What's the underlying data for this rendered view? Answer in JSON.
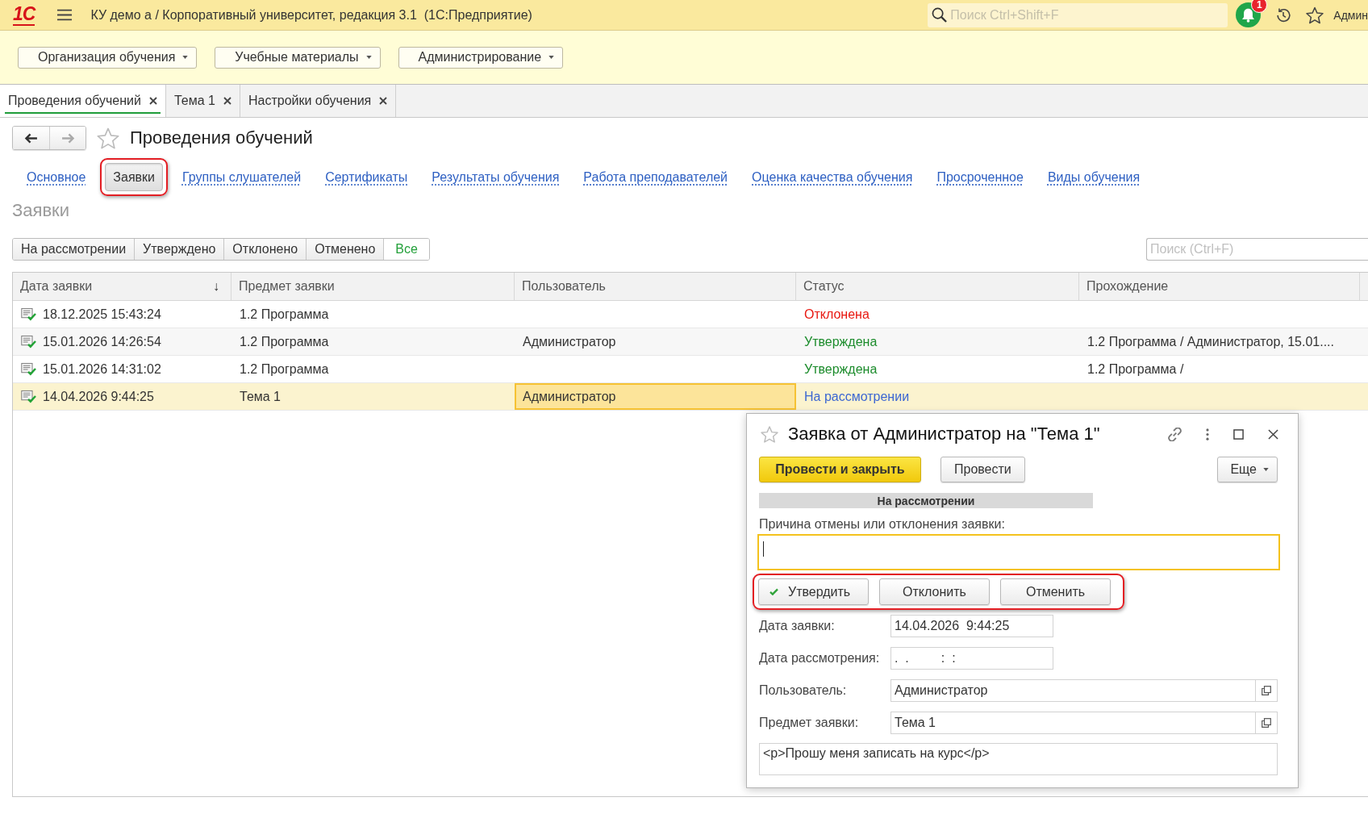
{
  "top_bar": {
    "logo": "1С",
    "title": "КУ демо а / Корпоративный университет, редакция 3.1  (1С:Предприятие)",
    "search": {
      "placeholder": "Поиск Ctrl+Shift+F"
    },
    "notifications": "1",
    "user": "Админ"
  },
  "sections": [
    {
      "label": "Организация обучения"
    },
    {
      "label": "Учебные материалы"
    },
    {
      "label": "Администрирование"
    }
  ],
  "open_tabs": [
    {
      "label": "Проведения обучений",
      "selected": true
    },
    {
      "label": "Тема 1",
      "selected": false
    },
    {
      "label": "Настройки обучения",
      "selected": false
    }
  ],
  "page": {
    "history_buttons": [
      {
        "kind": "back",
        "disabled": false
      },
      {
        "kind": "forward",
        "disabled": true
      }
    ],
    "favorite": false,
    "title": "Проведения обучений",
    "nav_links": [
      {
        "label": "Основное",
        "selected": false,
        "highlighted": false
      },
      {
        "label": "Заявки",
        "selected": true,
        "highlighted": true
      },
      {
        "label": "Группы слушателей",
        "selected": false,
        "highlighted": false
      },
      {
        "label": "Сертификаты",
        "selected": false,
        "highlighted": false
      },
      {
        "label": "Результаты обучения",
        "selected": false,
        "highlighted": false
      },
      {
        "label": "Работа преподавателей",
        "selected": false,
        "highlighted": false
      },
      {
        "label": "Оценка качества обучения",
        "selected": false,
        "highlighted": false
      },
      {
        "label": "Просроченное",
        "selected": false,
        "highlighted": false
      },
      {
        "label": "Виды обучения",
        "selected": false,
        "highlighted": false
      }
    ],
    "section_title": "Заявки",
    "filters": [
      {
        "label": "На рассмотрении",
        "selected": false
      },
      {
        "label": "Утверждено",
        "selected": false
      },
      {
        "label": "Отклонено",
        "selected": false
      },
      {
        "label": "Отменено",
        "selected": false
      },
      {
        "label": "Все",
        "selected": true
      }
    ],
    "search": {
      "placeholder": "Поиск (Ctrl+F)"
    },
    "table": {
      "columns": [
        {
          "label": "Дата заявки",
          "sort_mark": "↓"
        },
        {
          "label": "Предмет заявки"
        },
        {
          "label": "Пользователь"
        },
        {
          "label": "Статус"
        },
        {
          "label": "Прохождение"
        }
      ],
      "rows": [
        {
          "selected": false,
          "cells": [
            {
              "text": "18.12.2025 15:43:24",
              "focused": false
            },
            {
              "text": "1.2 Программа",
              "focused": false
            },
            {
              "focused": false
            },
            {
              "text": "Отклонена",
              "color": "#e8170f",
              "focused": false
            },
            {
              "focused": false
            }
          ]
        },
        {
          "selected": false,
          "cells": [
            {
              "text": "15.01.2026 14:26:54",
              "focused": false
            },
            {
              "text": "1.2 Программа",
              "focused": false
            },
            {
              "text": "Администратор",
              "focused": false
            },
            {
              "text": "Утверждена",
              "color": "#1c8c2c",
              "focused": false
            },
            {
              "text": "1.2 Программа / Администратор, 15.01....",
              "focused": false
            }
          ]
        },
        {
          "selected": false,
          "cells": [
            {
              "text": "15.01.2026 14:31:02",
              "focused": false
            },
            {
              "text": "1.2 Программа",
              "focused": false
            },
            {
              "focused": false
            },
            {
              "text": "Утверждена",
              "color": "#1c8c2c",
              "focused": false
            },
            {
              "text": "1.2 Программа /",
              "focused": false
            }
          ]
        },
        {
          "selected": true,
          "cells": [
            {
              "text": "14.04.2026 9:44:25",
              "focused": false
            },
            {
              "text": "Тема 1",
              "focused": false
            },
            {
              "text": "Администратор",
              "focused": true
            },
            {
              "text": "На рассмотрении",
              "color": "#3c67d2",
              "focused": false
            },
            {
              "focused": false
            }
          ]
        }
      ]
    }
  },
  "dialog": {
    "favorite": false,
    "title": "Заявка от Администратор на \"Тема 1\"",
    "toolbar": [
      {
        "label": "Провести и закрыть",
        "kind": "primary"
      },
      {
        "label": "Провести",
        "kind": "default"
      },
      {
        "label": "Еще",
        "kind": "menu"
      }
    ],
    "status_banner": "На рассмотрении",
    "reason": {
      "label": "Причина отмены или отклонения заявки:",
      "focused": true
    },
    "actions": {
      "highlighted": true,
      "buttons": [
        {
          "label": "Утвердить",
          "kind": "approve"
        },
        {
          "label": "Отклонить",
          "kind": "default"
        },
        {
          "label": "Отменить",
          "kind": "default"
        }
      ]
    },
    "fields": [
      {
        "label": "Дата заявки:",
        "value": "14.04.2026  9:44:25",
        "kind": "date"
      },
      {
        "label": "Дата рассмотрения:",
        "value": ".  .         :  :",
        "kind": "date"
      },
      {
        "label": "Пользователь:",
        "value": "Администратор",
        "kind": "reference"
      },
      {
        "label": "Предмет заявки:",
        "value": "Тема 1",
        "kind": "reference"
      }
    ],
    "comment": "<p>Прошу меня записать на курс</p>"
  }
}
